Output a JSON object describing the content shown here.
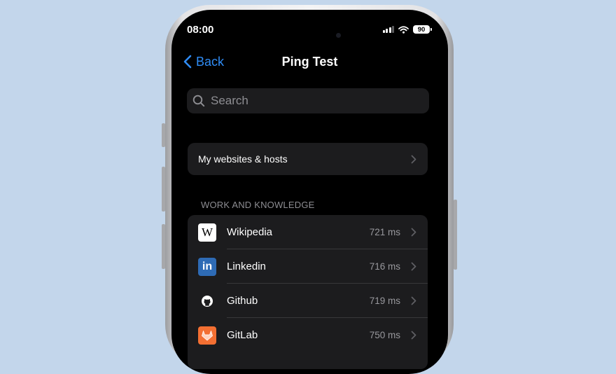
{
  "status_bar": {
    "time": "08:00",
    "battery": "90"
  },
  "nav": {
    "back_label": "Back",
    "title": "Ping Test"
  },
  "search": {
    "placeholder": "Search"
  },
  "my_sites": {
    "label": "My websites & hosts"
  },
  "section": {
    "header": "WORK AND KNOWLEDGE",
    "items": [
      {
        "name": "Wikipedia",
        "latency": "721 ms",
        "icon": "wikipedia-logo-icon"
      },
      {
        "name": "Linkedin",
        "latency": "716 ms",
        "icon": "linkedin-logo-icon"
      },
      {
        "name": "Github",
        "latency": "719 ms",
        "icon": "github-logo-icon"
      },
      {
        "name": "GitLab",
        "latency": "750 ms",
        "icon": "gitlab-logo-icon"
      }
    ]
  },
  "colors": {
    "background": "#c3d6eb",
    "accent": "#2f8cf5",
    "cell": "#1c1c1e",
    "secondary_text": "#98989d",
    "linkedin": "#2e6bb5",
    "gitlab": "#f36f32"
  }
}
